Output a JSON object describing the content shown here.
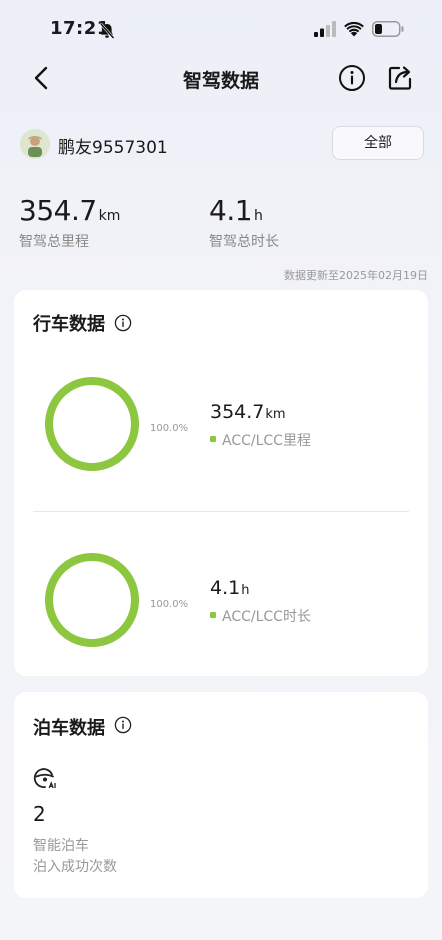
{
  "status": {
    "time": "17:21"
  },
  "nav": {
    "title": "智驾数据"
  },
  "user": {
    "name": "鹏友9557301",
    "filter_label": "全部"
  },
  "summary": {
    "mileage_value": "354.7",
    "mileage_unit": "km",
    "mileage_label": "智驾总里程",
    "duration_value": "4.1",
    "duration_unit": "h",
    "duration_label": "智驾总时长",
    "updated_text": "数据更新至2025年02月19日"
  },
  "driving": {
    "title": "行车数据",
    "mileage": {
      "percent": "100.0%",
      "percent_value": 1.0,
      "value": "354.7",
      "unit": "km",
      "label": "ACC/LCC里程"
    },
    "duration": {
      "percent": "100.0%",
      "percent_value": 1.0,
      "value": "4.1",
      "unit": "h",
      "label": "ACC/LCC时长"
    },
    "ring_color": "#8dc63f"
  },
  "parking": {
    "title": "泊车数据",
    "icon": "steering-ai-icon",
    "count": "2",
    "label_1": "智能泊车",
    "label_2": "泊入成功次数"
  }
}
